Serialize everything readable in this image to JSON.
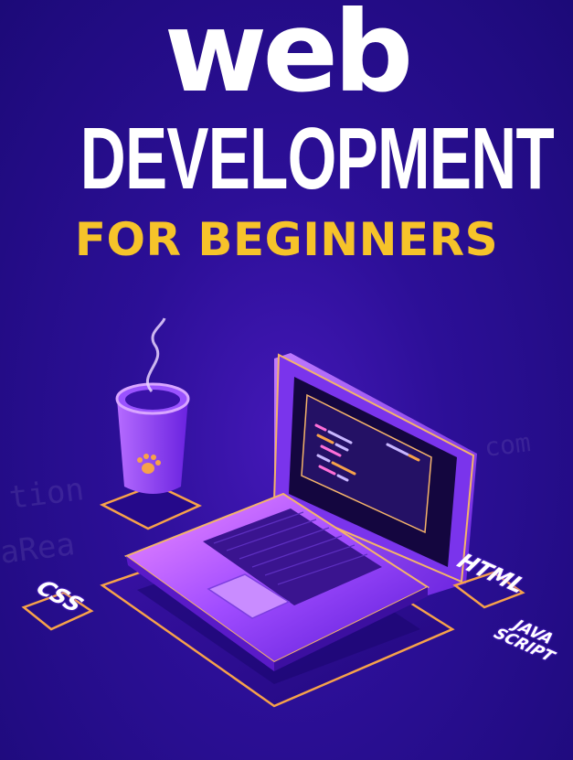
{
  "title": {
    "line1": "web",
    "line2": "DEVELOPMENT",
    "line3": "FOR BEGINNERS"
  },
  "tags": {
    "css": "CSS",
    "html": "HTML",
    "js_line1": "JAVA",
    "js_line2": "SCRIPT"
  },
  "watermark": {
    "line1": "tion",
    "line2": "aRea",
    "line3": "com"
  },
  "colors": {
    "background": "#2c0f97",
    "title": "#ffffff",
    "subtitle": "#f6c32a",
    "glow": "#f7a24a",
    "laptop": "#a35cff"
  },
  "icons": [
    "coffee-cup-icon",
    "paw-icon",
    "laptop-icon"
  ]
}
